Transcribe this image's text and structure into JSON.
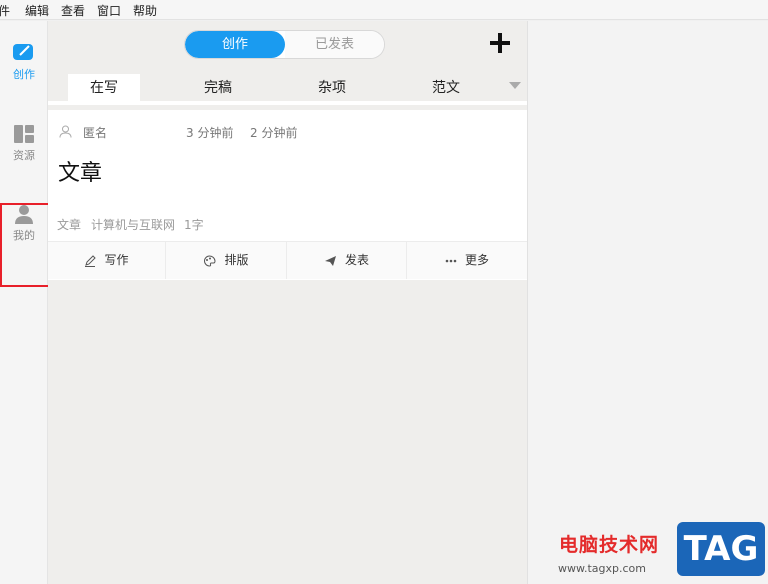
{
  "menubar": {
    "items": [
      "件",
      "编辑",
      "查看",
      "窗口",
      "帮助"
    ]
  },
  "sidebar": {
    "items": [
      {
        "label": "创作",
        "icon": "compose-icon",
        "active": true
      },
      {
        "label": "资源",
        "icon": "grid-icon",
        "active": false
      },
      {
        "label": "我的",
        "icon": "person-icon",
        "active": false
      }
    ]
  },
  "segment": {
    "options": [
      "创作",
      "已发表"
    ],
    "selected": "创作"
  },
  "toolbar": {
    "add_icon": "plus-icon"
  },
  "tabs": {
    "items": [
      "在写",
      "完稿",
      "杂项",
      "范文"
    ],
    "active": "在写"
  },
  "card": {
    "author": "匿名",
    "created": "3 分钟前",
    "modified": "2 分钟前",
    "title": "文章",
    "category": "文章",
    "tag": "计算机与互联网",
    "word_count": "1字"
  },
  "actions": {
    "items": [
      {
        "label": "写作",
        "icon": "pencil-icon"
      },
      {
        "label": "排版",
        "icon": "palette-icon"
      },
      {
        "label": "发表",
        "icon": "send-icon"
      },
      {
        "label": "更多",
        "icon": "more-icon"
      }
    ]
  },
  "watermark": {
    "site_name": "电脑技术网",
    "url": "www.tagxp.com",
    "badge": "TAG"
  },
  "colors": {
    "accent": "#1a9bf0",
    "highlight_box": "#e8202a"
  }
}
